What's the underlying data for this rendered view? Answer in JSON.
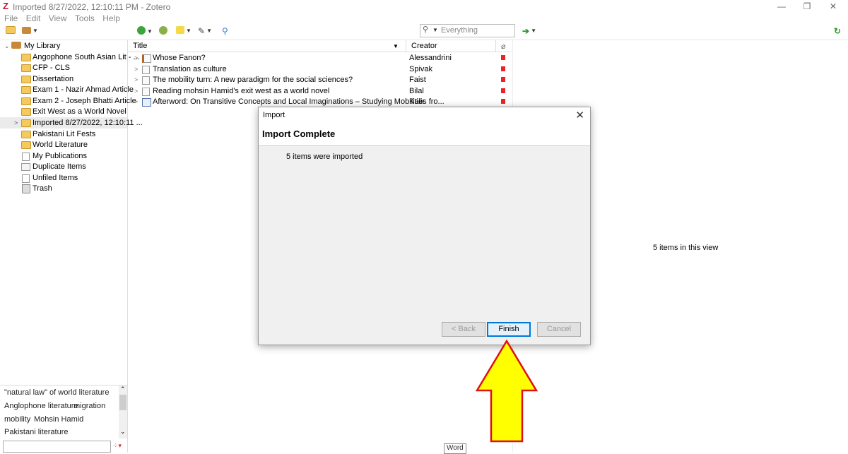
{
  "window": {
    "title": "Imported 8/27/2022, 12:10:11 PM - Zotero",
    "app_icon": "Z",
    "minimize_glyph": "—",
    "restore_glyph": "❐",
    "close_glyph": "✕"
  },
  "menu": [
    "File",
    "Edit",
    "View",
    "Tools",
    "Help"
  ],
  "search": {
    "placeholder": "Everything"
  },
  "collections": [
    {
      "label": "My Library",
      "type": "library",
      "expanded": true
    },
    {
      "label": "Angophone South Asian Lit - ...",
      "type": "folder"
    },
    {
      "label": "CFP - CLS",
      "type": "folder"
    },
    {
      "label": "Dissertation",
      "type": "folder"
    },
    {
      "label": "Exam 1 - Nazir Ahmad Article",
      "type": "folder"
    },
    {
      "label": "Exam 2 - Joseph Bhatti Article",
      "type": "folder"
    },
    {
      "label": "Exit West as a World Novel",
      "type": "folder"
    },
    {
      "label": "Imported 8/27/2022, 12:10:11 ...",
      "type": "folder",
      "selected": true
    },
    {
      "label": "Pakistani Lit Fests",
      "type": "folder"
    },
    {
      "label": "World Literature",
      "type": "folder"
    },
    {
      "label": "My Publications",
      "type": "publications"
    },
    {
      "label": "Duplicate Items",
      "type": "duplicates"
    },
    {
      "label": "Unfiled Items",
      "type": "unfiled"
    },
    {
      "label": "Trash",
      "type": "trash"
    }
  ],
  "tags": {
    "row1": [
      "\"natural law\" of world literature"
    ],
    "row2": [
      "Anglophone literature",
      "migration"
    ],
    "row3": [
      "mobility",
      "Mohsin Hamid"
    ],
    "row4": [
      "Pakistani literature"
    ]
  },
  "items_table": {
    "columns": [
      "Title",
      "Creator"
    ],
    "rows": [
      {
        "title": "Whose Fanon?",
        "creator": "Alessandrini",
        "icon": "journal-article-icon"
      },
      {
        "title": "Translation as culture",
        "creator": "Spivak",
        "icon": "document-icon"
      },
      {
        "title": "The mobility turn: A new paradigm for the social sciences?",
        "creator": "Faist",
        "icon": "document-icon"
      },
      {
        "title": "Reading mohsin Hamid's exit west as a world novel",
        "creator": "Bilal",
        "icon": "document-icon"
      },
      {
        "title": "Afterword: On Transitive Concepts and Local Imaginations – Studying Mobilities fro...",
        "creator": "Kalir",
        "icon": "book-icon"
      }
    ]
  },
  "right_pane": {
    "count_text": "5 items in this view"
  },
  "dialog": {
    "title": "Import",
    "heading": "Import Complete",
    "message": "5 items were imported",
    "close_glyph": "✕",
    "buttons": {
      "back": "< Back",
      "finish": "Finish",
      "cancel": "Cancel"
    }
  },
  "tooltip": {
    "text": "Word"
  },
  "colors": {
    "arrow_fill": "#ffff00",
    "arrow_stroke": "#e01010",
    "accent": "#0078d7"
  }
}
